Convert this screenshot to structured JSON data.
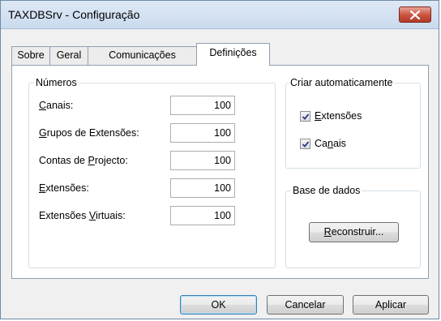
{
  "window": {
    "title": "TAXDBSrv - Configuração"
  },
  "tabs": [
    {
      "label": "Sobre",
      "active": false
    },
    {
      "label": "Geral",
      "active": false
    },
    {
      "label": "Comunicações",
      "active": false
    },
    {
      "label": "Definições",
      "active": true
    }
  ],
  "numeros": {
    "legend": "Números",
    "fields": [
      {
        "label_pre": "",
        "label_ul": "C",
        "label_post": "anais:",
        "value": "100"
      },
      {
        "label_pre": "",
        "label_ul": "G",
        "label_post": "rupos de Extensões:",
        "value": "100"
      },
      {
        "label_pre": "Contas de ",
        "label_ul": "P",
        "label_post": "rojecto:",
        "value": "100"
      },
      {
        "label_pre": "",
        "label_ul": "E",
        "label_post": "xtensões:",
        "value": "100"
      },
      {
        "label_pre": "Extensões ",
        "label_ul": "V",
        "label_post": "irtuais:",
        "value": "100"
      }
    ]
  },
  "criar": {
    "legend": "Criar automaticamente",
    "extensoes": {
      "label_pre": "",
      "label_ul": "E",
      "label_post": "xtensões",
      "checked": true
    },
    "canais": {
      "label_pre": "Ca",
      "label_ul": "n",
      "label_post": "ais",
      "checked": true
    }
  },
  "base": {
    "legend": "Base de dados",
    "rebuild": {
      "label_pre": "",
      "label_ul": "R",
      "label_post": "econstruir..."
    }
  },
  "buttons": {
    "ok": "OK",
    "cancel": "Cancelar",
    "apply": "Aplicar"
  }
}
